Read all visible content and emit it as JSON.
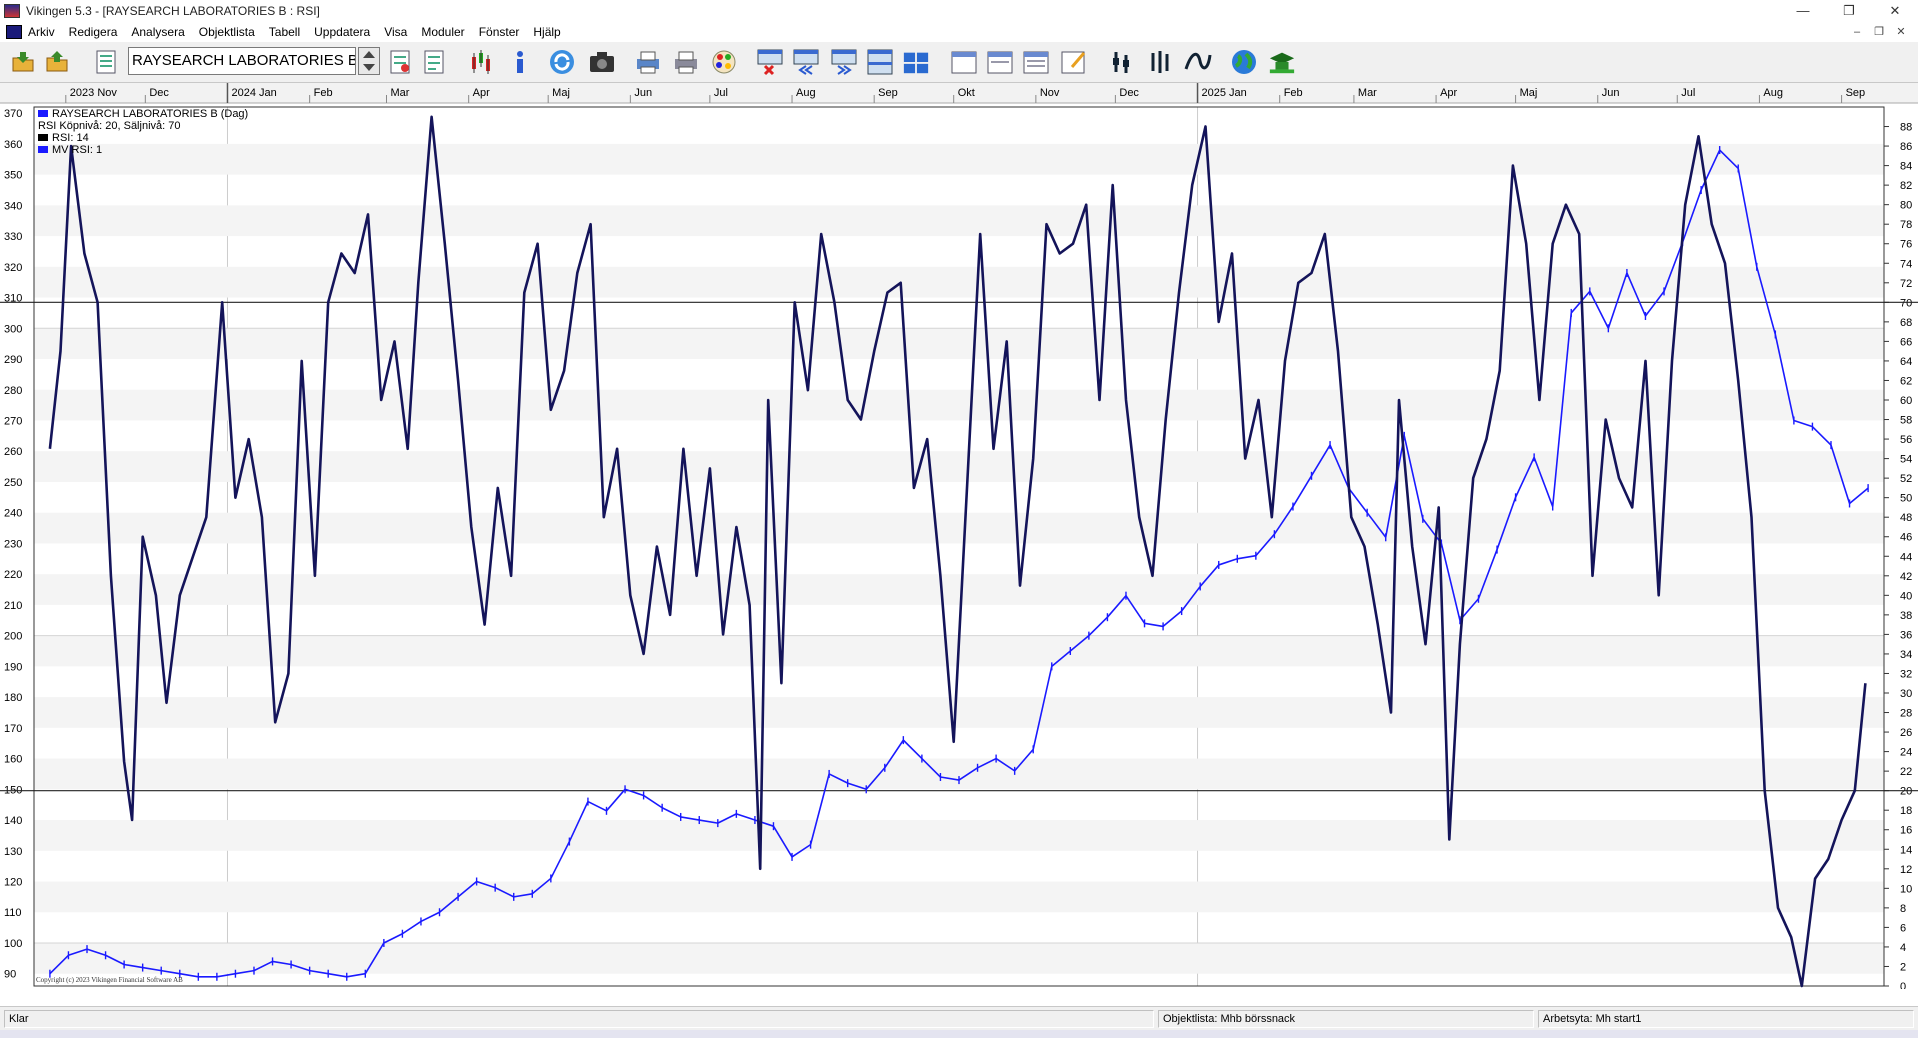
{
  "window": {
    "title": "Vikingen 5.3 - [RAYSEARCH LABORATORIES B : RSI]",
    "controls": [
      "—",
      "❐",
      "✕"
    ]
  },
  "menu": [
    "Arkiv",
    "Redigera",
    "Analysera",
    "Objektlista",
    "Tabell",
    "Uppdatera",
    "Visa",
    "Moduler",
    "Fönster",
    "Hjälp"
  ],
  "mdi_controls": [
    "–",
    "❐",
    "✕"
  ],
  "toolbar": {
    "symbol": "RAYSEARCH LABORATORIES B"
  },
  "chart": {
    "month_labels": [
      "2023 Nov",
      "Dec",
      "2024 Jan",
      "Feb",
      "Mar",
      "Apr",
      "Maj",
      "Jun",
      "Jul",
      "Aug",
      "Sep",
      "Okt",
      "Nov",
      "Dec",
      "2025 Jan",
      "Feb",
      "Mar",
      "Apr",
      "Maj",
      "Jun",
      "Jul",
      "Aug",
      "Sep"
    ],
    "left_axis": [
      "370",
      "360",
      "350",
      "340",
      "330",
      "320",
      "310",
      "300",
      "290",
      "280",
      "270",
      "260",
      "250",
      "240",
      "230",
      "220",
      "210",
      "200",
      "190",
      "180",
      "170",
      "160",
      "150",
      "140",
      "130",
      "120",
      "110",
      "100",
      "90"
    ],
    "right_axis": [
      "88",
      "86",
      "84",
      "82",
      "80",
      "78",
      "76",
      "74",
      "72",
      "70",
      "68",
      "66",
      "64",
      "62",
      "60",
      "58",
      "56",
      "54",
      "52",
      "50",
      "48",
      "46",
      "44",
      "42",
      "40",
      "38",
      "36",
      "34",
      "32",
      "30",
      "28",
      "26",
      "24",
      "22",
      "20",
      "18",
      "16",
      "14",
      "12",
      "10",
      "8",
      "6",
      "4",
      "2",
      "0"
    ],
    "legend": [
      "RAYSEARCH LABORATORIES B (Dag)",
      "RSI  Köpnivå: 20, Säljnivå: 70",
      "RSI: 14",
      "MV RSI: 1"
    ],
    "copyright": "Copyright (c) 2023 Vikingen Financial Software AB",
    "colors": {
      "price": "#1a1aff",
      "rsi": "#14145a",
      "grid": "#d4d4d4",
      "band": "#f4f4f4"
    },
    "rsi_levels": {
      "buy": 20,
      "sell": 70
    }
  },
  "chart_data": {
    "type": "line",
    "price_range": [
      86,
      372
    ],
    "rsi_range": [
      0,
      90
    ],
    "price_series": {
      "name": "RAYSEARCH LABORATORIES B (Dag)",
      "points": [
        [
          "2023-10-26",
          90
        ],
        [
          "2023-11-02",
          96
        ],
        [
          "2023-11-09",
          98
        ],
        [
          "2023-11-16",
          96
        ],
        [
          "2023-11-23",
          93
        ],
        [
          "2023-11-30",
          92
        ],
        [
          "2023-12-07",
          91
        ],
        [
          "2023-12-14",
          90
        ],
        [
          "2023-12-21",
          89
        ],
        [
          "2023-12-28",
          89
        ],
        [
          "2024-01-04",
          90
        ],
        [
          "2024-01-11",
          91
        ],
        [
          "2024-01-18",
          94
        ],
        [
          "2024-01-25",
          93
        ],
        [
          "2024-02-01",
          91
        ],
        [
          "2024-02-08",
          90
        ],
        [
          "2024-02-15",
          89
        ],
        [
          "2024-02-22",
          90
        ],
        [
          "2024-02-29",
          100
        ],
        [
          "2024-03-07",
          103
        ],
        [
          "2024-03-14",
          107
        ],
        [
          "2024-03-21",
          110
        ],
        [
          "2024-03-28",
          115
        ],
        [
          "2024-04-04",
          120
        ],
        [
          "2024-04-11",
          118
        ],
        [
          "2024-04-18",
          115
        ],
        [
          "2024-04-25",
          116
        ],
        [
          "2024-05-02",
          121
        ],
        [
          "2024-05-09",
          133
        ],
        [
          "2024-05-16",
          146
        ],
        [
          "2024-05-23",
          143
        ],
        [
          "2024-05-30",
          150
        ],
        [
          "2024-06-06",
          148
        ],
        [
          "2024-06-13",
          144
        ],
        [
          "2024-06-20",
          141
        ],
        [
          "2024-06-27",
          140
        ],
        [
          "2024-07-04",
          139
        ],
        [
          "2024-07-11",
          142
        ],
        [
          "2024-07-18",
          140
        ],
        [
          "2024-07-25",
          138
        ],
        [
          "2024-08-01",
          128
        ],
        [
          "2024-08-08",
          132
        ],
        [
          "2024-08-15",
          155
        ],
        [
          "2024-08-22",
          152
        ],
        [
          "2024-08-29",
          150
        ],
        [
          "2024-09-05",
          157
        ],
        [
          "2024-09-12",
          166
        ],
        [
          "2024-09-19",
          160
        ],
        [
          "2024-09-26",
          154
        ],
        [
          "2024-10-03",
          153
        ],
        [
          "2024-10-10",
          157
        ],
        [
          "2024-10-17",
          160
        ],
        [
          "2024-10-24",
          156
        ],
        [
          "2024-10-31",
          163
        ],
        [
          "2024-11-07",
          190
        ],
        [
          "2024-11-14",
          195
        ],
        [
          "2024-11-21",
          200
        ],
        [
          "2024-11-28",
          206
        ],
        [
          "2024-12-05",
          213
        ],
        [
          "2024-12-12",
          204
        ],
        [
          "2024-12-19",
          203
        ],
        [
          "2024-12-26",
          208
        ],
        [
          "2025-01-02",
          216
        ],
        [
          "2025-01-09",
          223
        ],
        [
          "2025-01-16",
          225
        ],
        [
          "2025-01-23",
          226
        ],
        [
          "2025-01-30",
          233
        ],
        [
          "2025-02-06",
          242
        ],
        [
          "2025-02-13",
          252
        ],
        [
          "2025-02-20",
          262
        ],
        [
          "2025-02-27",
          248
        ],
        [
          "2025-03-06",
          240
        ],
        [
          "2025-03-13",
          232
        ],
        [
          "2025-03-20",
          265
        ],
        [
          "2025-03-27",
          238
        ],
        [
          "2025-04-03",
          230
        ],
        [
          "2025-04-10",
          205
        ],
        [
          "2025-04-17",
          212
        ],
        [
          "2025-04-24",
          228
        ],
        [
          "2025-05-01",
          245
        ],
        [
          "2025-05-08",
          258
        ],
        [
          "2025-05-15",
          242
        ],
        [
          "2025-05-22",
          305
        ],
        [
          "2025-05-29",
          312
        ],
        [
          "2025-06-05",
          300
        ],
        [
          "2025-06-12",
          318
        ],
        [
          "2025-06-19",
          304
        ],
        [
          "2025-06-26",
          312
        ],
        [
          "2025-07-03",
          328
        ],
        [
          "2025-07-10",
          345
        ],
        [
          "2025-07-17",
          358
        ],
        [
          "2025-07-24",
          352
        ],
        [
          "2025-07-31",
          320
        ],
        [
          "2025-08-07",
          298
        ],
        [
          "2025-08-14",
          270
        ],
        [
          "2025-08-21",
          268
        ],
        [
          "2025-08-28",
          262
        ],
        [
          "2025-09-04",
          243
        ],
        [
          "2025-09-11",
          248
        ]
      ]
    },
    "rsi_series": {
      "name": "RSI: 14",
      "points": [
        [
          "2023-10-26",
          55
        ],
        [
          "2023-10-30",
          65
        ],
        [
          "2023-11-03",
          86
        ],
        [
          "2023-11-08",
          75
        ],
        [
          "2023-11-13",
          70
        ],
        [
          "2023-11-18",
          42
        ],
        [
          "2023-11-23",
          23
        ],
        [
          "2023-11-26",
          17
        ],
        [
          "2023-11-30",
          46
        ],
        [
          "2023-12-05",
          40
        ],
        [
          "2023-12-09",
          29
        ],
        [
          "2023-12-14",
          40
        ],
        [
          "2023-12-19",
          44
        ],
        [
          "2023-12-24",
          48
        ],
        [
          "2023-12-30",
          70
        ],
        [
          "2024-01-04",
          50
        ],
        [
          "2024-01-09",
          56
        ],
        [
          "2024-01-14",
          48
        ],
        [
          "2024-01-19",
          27
        ],
        [
          "2024-01-24",
          32
        ],
        [
          "2024-01-29",
          64
        ],
        [
          "2024-02-03",
          42
        ],
        [
          "2024-02-08",
          70
        ],
        [
          "2024-02-13",
          75
        ],
        [
          "2024-02-18",
          73
        ],
        [
          "2024-02-23",
          79
        ],
        [
          "2024-02-28",
          60
        ],
        [
          "2024-03-04",
          66
        ],
        [
          "2024-03-09",
          55
        ],
        [
          "2024-03-13",
          72
        ],
        [
          "2024-03-18",
          89
        ],
        [
          "2024-03-23",
          76
        ],
        [
          "2024-03-28",
          62
        ],
        [
          "2024-04-02",
          47
        ],
        [
          "2024-04-07",
          37
        ],
        [
          "2024-04-12",
          51
        ],
        [
          "2024-04-17",
          42
        ],
        [
          "2024-04-22",
          71
        ],
        [
          "2024-04-27",
          76
        ],
        [
          "2024-05-02",
          59
        ],
        [
          "2024-05-07",
          63
        ],
        [
          "2024-05-12",
          73
        ],
        [
          "2024-05-17",
          78
        ],
        [
          "2024-05-22",
          48
        ],
        [
          "2024-05-27",
          55
        ],
        [
          "2024-06-01",
          40
        ],
        [
          "2024-06-06",
          34
        ],
        [
          "2024-06-11",
          45
        ],
        [
          "2024-06-16",
          38
        ],
        [
          "2024-06-21",
          55
        ],
        [
          "2024-06-26",
          42
        ],
        [
          "2024-07-01",
          53
        ],
        [
          "2024-07-06",
          36
        ],
        [
          "2024-07-11",
          47
        ],
        [
          "2024-07-16",
          39
        ],
        [
          "2024-07-20",
          12
        ],
        [
          "2024-07-23",
          60
        ],
        [
          "2024-07-28",
          31
        ],
        [
          "2024-08-02",
          70
        ],
        [
          "2024-08-07",
          61
        ],
        [
          "2024-08-12",
          77
        ],
        [
          "2024-08-17",
          70
        ],
        [
          "2024-08-22",
          60
        ],
        [
          "2024-08-27",
          58
        ],
        [
          "2024-09-01",
          65
        ],
        [
          "2024-09-06",
          71
        ],
        [
          "2024-09-11",
          72
        ],
        [
          "2024-09-16",
          51
        ],
        [
          "2024-09-21",
          56
        ],
        [
          "2024-09-26",
          42
        ],
        [
          "2024-10-01",
          25
        ],
        [
          "2024-10-06",
          51
        ],
        [
          "2024-10-11",
          77
        ],
        [
          "2024-10-16",
          55
        ],
        [
          "2024-10-21",
          66
        ],
        [
          "2024-10-26",
          41
        ],
        [
          "2024-10-31",
          54
        ],
        [
          "2024-11-05",
          78
        ],
        [
          "2024-11-10",
          75
        ],
        [
          "2024-11-15",
          76
        ],
        [
          "2024-11-20",
          80
        ],
        [
          "2024-11-25",
          60
        ],
        [
          "2024-11-30",
          82
        ],
        [
          "2024-12-05",
          60
        ],
        [
          "2024-12-10",
          48
        ],
        [
          "2024-12-15",
          42
        ],
        [
          "2024-12-20",
          58
        ],
        [
          "2024-12-25",
          71
        ],
        [
          "2024-12-30",
          82
        ],
        [
          "2025-01-04",
          88
        ],
        [
          "2025-01-09",
          68
        ],
        [
          "2025-01-14",
          75
        ],
        [
          "2025-01-19",
          54
        ],
        [
          "2025-01-24",
          60
        ],
        [
          "2025-01-29",
          48
        ],
        [
          "2025-02-03",
          64
        ],
        [
          "2025-02-08",
          72
        ],
        [
          "2025-02-13",
          73
        ],
        [
          "2025-02-18",
          77
        ],
        [
          "2025-02-23",
          65
        ],
        [
          "2025-02-28",
          48
        ],
        [
          "2025-03-05",
          45
        ],
        [
          "2025-03-10",
          37
        ],
        [
          "2025-03-15",
          28
        ],
        [
          "2025-03-18",
          60
        ],
        [
          "2025-03-23",
          45
        ],
        [
          "2025-03-28",
          35
        ],
        [
          "2025-04-02",
          49
        ],
        [
          "2025-04-06",
          15
        ],
        [
          "2025-04-10",
          35
        ],
        [
          "2025-04-15",
          52
        ],
        [
          "2025-04-20",
          56
        ],
        [
          "2025-04-25",
          63
        ],
        [
          "2025-04-30",
          84
        ],
        [
          "2025-05-05",
          76
        ],
        [
          "2025-05-10",
          60
        ],
        [
          "2025-05-15",
          76
        ],
        [
          "2025-05-20",
          80
        ],
        [
          "2025-05-25",
          77
        ],
        [
          "2025-05-30",
          42
        ],
        [
          "2025-06-04",
          58
        ],
        [
          "2025-06-09",
          52
        ],
        [
          "2025-06-14",
          49
        ],
        [
          "2025-06-19",
          64
        ],
        [
          "2025-06-24",
          40
        ],
        [
          "2025-06-29",
          64
        ],
        [
          "2025-07-04",
          80
        ],
        [
          "2025-07-09",
          87
        ],
        [
          "2025-07-14",
          78
        ],
        [
          "2025-07-19",
          74
        ],
        [
          "2025-07-24",
          62
        ],
        [
          "2025-07-29",
          48
        ],
        [
          "2025-08-03",
          20
        ],
        [
          "2025-08-08",
          8
        ],
        [
          "2025-08-13",
          5
        ],
        [
          "2025-08-17",
          0
        ],
        [
          "2025-08-22",
          11
        ],
        [
          "2025-08-27",
          13
        ],
        [
          "2025-09-01",
          17
        ],
        [
          "2025-09-06",
          20
        ],
        [
          "2025-09-10",
          31
        ]
      ]
    },
    "xlim": [
      "2023-10-20",
      "2025-09-17"
    ],
    "xlabel": "",
    "ylabel": "",
    "grid": true
  },
  "status": {
    "left": "Klar",
    "middle": "Objektlista: Mhb börssnack",
    "right": "Arbetsyta: Mh start1"
  }
}
